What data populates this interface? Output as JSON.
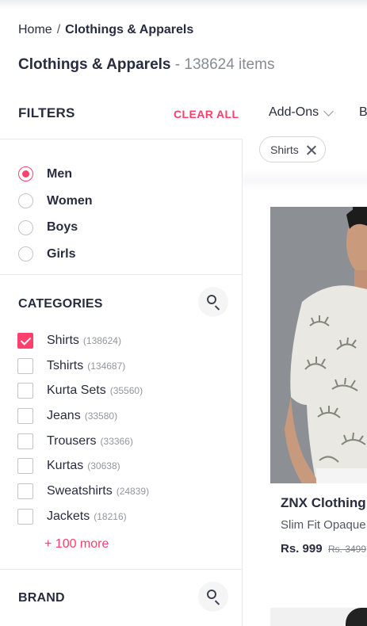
{
  "breadcrumb": {
    "home": "Home",
    "separator": "/",
    "current": "Clothings & Apparels"
  },
  "title": {
    "name": "Clothings & Apparels",
    "count": "- 138624 items"
  },
  "filters": {
    "heading": "FILTERS",
    "clear_all": "CLEAR ALL"
  },
  "topbar": {
    "addons": "Add-Ons",
    "next_filter": "B"
  },
  "applied_chip": {
    "label": "Shirts"
  },
  "gender": {
    "options": [
      {
        "label": "Men",
        "selected": true
      },
      {
        "label": "Women",
        "selected": false
      },
      {
        "label": "Boys",
        "selected": false
      },
      {
        "label": "Girls",
        "selected": false
      }
    ]
  },
  "categories": {
    "heading": "CATEGORIES",
    "items": [
      {
        "label": "Shirts",
        "count": "(138624)",
        "checked": true
      },
      {
        "label": "Tshirts",
        "count": "(134687)",
        "checked": false
      },
      {
        "label": "Kurta Sets",
        "count": "(35560)",
        "checked": false
      },
      {
        "label": "Jeans",
        "count": "(33580)",
        "checked": false
      },
      {
        "label": "Trousers",
        "count": "(33366)",
        "checked": false
      },
      {
        "label": "Kurtas",
        "count": "(30638)",
        "checked": false
      },
      {
        "label": "Sweatshirts",
        "count": "(24839)",
        "checked": false
      },
      {
        "label": "Jackets",
        "count": "(18216)",
        "checked": false
      }
    ],
    "more": "+ 100 more"
  },
  "brand": {
    "heading": "BRAND"
  },
  "product": {
    "brand": "ZNX Clothing",
    "description": "Slim Fit Opaque",
    "price": "Rs. 999",
    "mrp": "Rs. 3499"
  },
  "colors": {
    "accent": "#ff3f6c",
    "text": "#282c3f",
    "muted": "#94969f"
  }
}
